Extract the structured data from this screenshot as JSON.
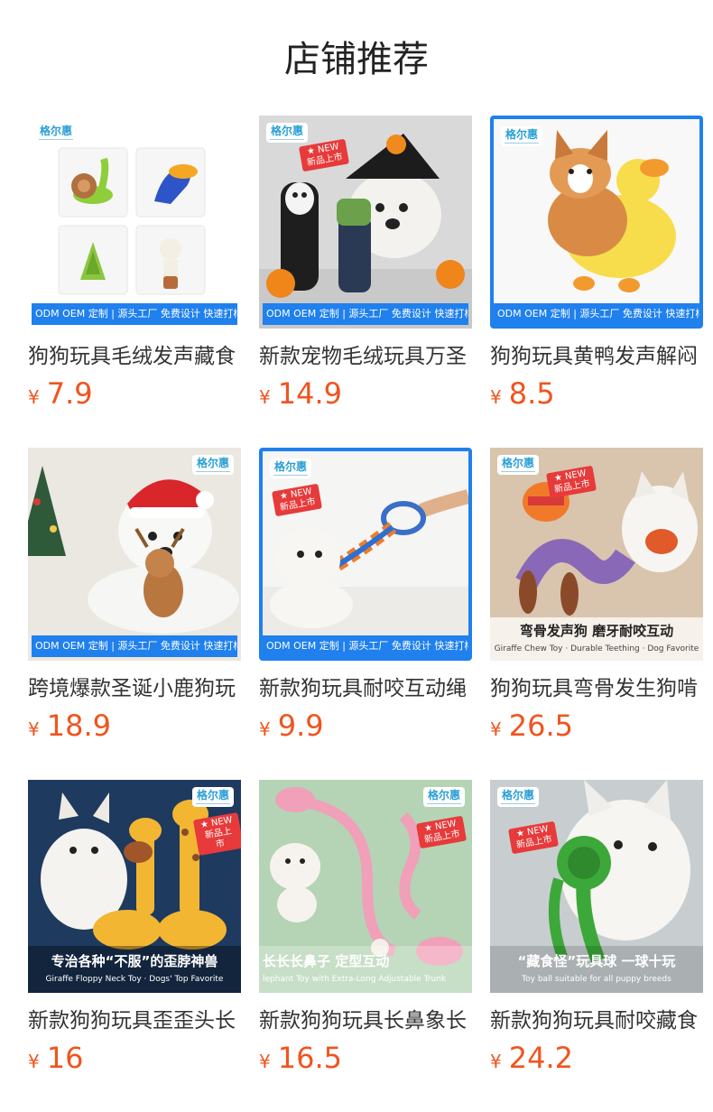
{
  "page_title": "店铺推荐",
  "accent_color": "#f0541e",
  "currency_symbol": "¥",
  "brand_logo_text": "格尔惠",
  "new_badge": {
    "line1": "★ NEW",
    "line2": "新品上市"
  },
  "service_banner": "ODM OEM 定制 | 源头工厂 免费设计 快速打样",
  "products": [
    {
      "name": "狗狗玩具毛绒发声藏食",
      "price": "7.9",
      "icon": "plush-toy-collage"
    },
    {
      "name": "新款宠物毛绒玩具万圣",
      "price": "14.9",
      "icon": "halloween-plush-dog"
    },
    {
      "name": "狗狗玩具黄鸭发声解闷",
      "price": "8.5",
      "icon": "yellow-duck-plush-corgi"
    },
    {
      "name": "跨境爆款圣诞小鹿狗玩",
      "price": "18.9",
      "icon": "christmas-deer-plush-dog"
    },
    {
      "name": "新款狗玩具耐咬互动绳",
      "price": "9.9",
      "icon": "rope-toy-dog"
    },
    {
      "name": "狗狗玩具弯骨发生狗啃",
      "price": "26.5",
      "icon": "bent-bone-plush-dog"
    },
    {
      "name": "新款狗狗玩具歪歪头长",
      "price": "16",
      "icon": "giraffe-plush-dog"
    },
    {
      "name": "新款狗狗玩具长鼻象长",
      "price": "16.5",
      "icon": "long-trunk-elephant-dog"
    },
    {
      "name": "新款狗狗玩具耐咬藏食",
      "price": "24.2",
      "icon": "green-ball-toy-dog"
    }
  ],
  "overlays": {
    "bent_bone": {
      "line1": "弯骨发声狗 磨牙耐咬互动",
      "line2": "Giraffe Chew Toy · Durable Teething · Dog Favorite"
    },
    "giraffe": {
      "line1": "专治各种“不服”的歪脖神兽",
      "line2": "Giraffe Floppy Neck Toy · Dogs' Top Favorite"
    },
    "elephant": {
      "line1": "长长长鼻子 定型互动",
      "line2": "lephant Toy with Extra-Long Adjustable Trunk"
    },
    "ball": {
      "line1": "“藏食怪”玩具球 一球十玩",
      "line2": "Toy ball suitable for all puppy breeds"
    }
  }
}
